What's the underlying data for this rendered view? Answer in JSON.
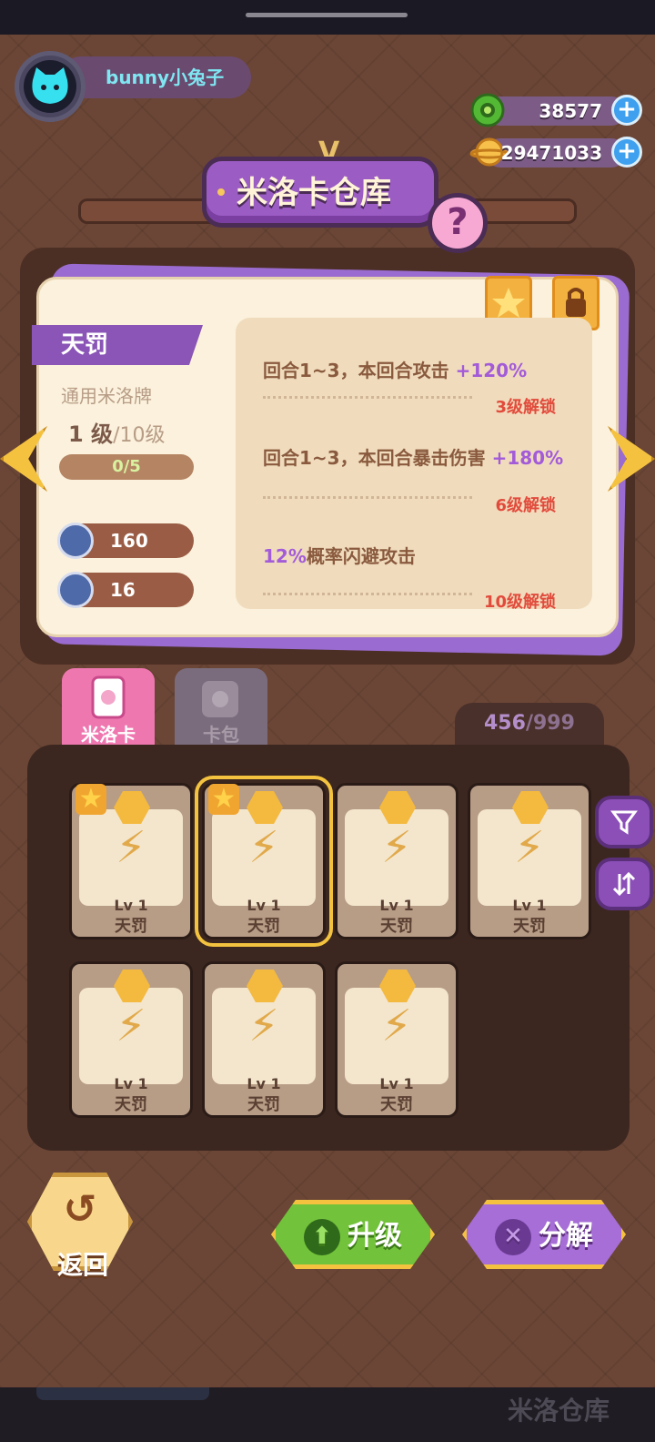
{
  "profile": {
    "username": "bunny小兔子"
  },
  "currencies": [
    {
      "icon": "green-coin-icon",
      "value": "38577"
    },
    {
      "icon": "gold-planet-icon",
      "value": "29471033"
    }
  ],
  "title": {
    "text": "米洛卡仓库",
    "help": "?"
  },
  "card": {
    "name": "天罚",
    "type": "通用米洛牌",
    "level": "1 级",
    "level_max": "/10级",
    "progress": "0/5",
    "progress_fraction": 0,
    "stats": [
      {
        "icon": "attack-icon",
        "value": "160"
      },
      {
        "icon": "defense-icon",
        "value": "16"
      }
    ],
    "perks": [
      {
        "pre": "回合1~3，本回合攻击 ",
        "hl": "+120%",
        "post": "",
        "unlock": "3级解锁"
      },
      {
        "pre": "回合1~3，本回合暴击伤害 ",
        "hl": "+180%",
        "post": "",
        "unlock": "6级解锁"
      },
      {
        "pre": "",
        "hl": "12%",
        "post": "概率闪避攻击",
        "unlock": "10级解锁"
      }
    ]
  },
  "tabs": [
    {
      "label": "米洛卡"
    },
    {
      "label": "卡包"
    }
  ],
  "inventory": {
    "count": "456",
    "capacity": "/999",
    "items": [
      {
        "lv": "Lv 1",
        "name": "天罚",
        "star": true,
        "selected": false
      },
      {
        "lv": "Lv 1",
        "name": "天罚",
        "star": true,
        "selected": true
      },
      {
        "lv": "Lv 1",
        "name": "天罚",
        "star": false,
        "selected": false
      },
      {
        "lv": "Lv 1",
        "name": "天罚",
        "star": false,
        "selected": false
      },
      {
        "lv": "Lv 1",
        "name": "天罚",
        "star": false,
        "selected": false
      },
      {
        "lv": "Lv 1",
        "name": "天罚",
        "star": false,
        "selected": false
      },
      {
        "lv": "Lv 1",
        "name": "天罚",
        "star": false,
        "selected": false
      }
    ]
  },
  "actions": {
    "back": "返回",
    "upgrade": "升级",
    "decompose": "分解"
  },
  "bottom_nav": {
    "ghost_label": "米洛仓库"
  }
}
